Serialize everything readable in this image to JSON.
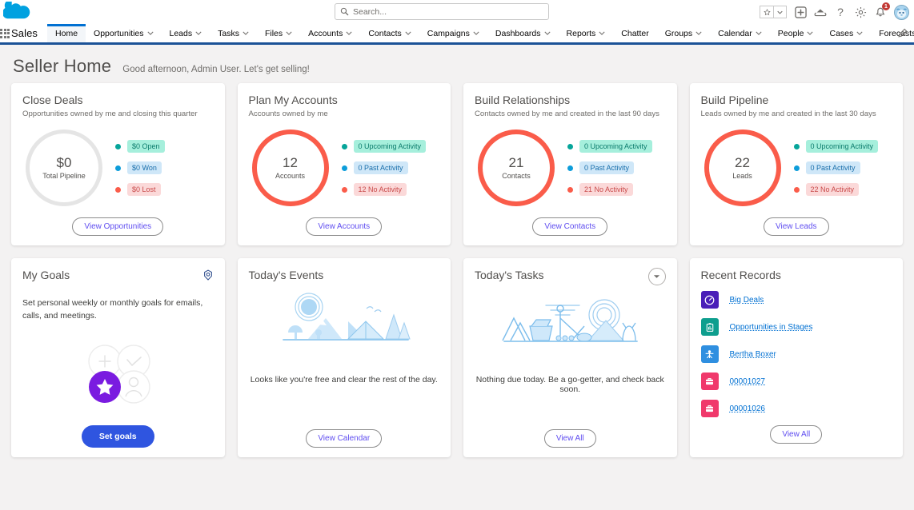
{
  "header": {
    "logo_icon": "salesforce-cloud-logo",
    "app_launcher_icon": "app-launcher-waffle-icon",
    "app_name": "Sales",
    "search": {
      "icon": "search-icon",
      "placeholder": "Search...",
      "value": ""
    },
    "actions": [
      {
        "name": "favorites-star-icon",
        "label": "★"
      },
      {
        "name": "favorites-dropdown-icon",
        "label": "▾"
      },
      {
        "name": "add-icon",
        "label": "+"
      },
      {
        "name": "learning-cloud-icon",
        "label": "☁"
      },
      {
        "name": "help-icon",
        "label": "?"
      },
      {
        "name": "setup-gear-icon",
        "label": "✿"
      },
      {
        "name": "notifications-bell-icon",
        "label": "🔔",
        "badge": "1"
      },
      {
        "name": "user-avatar",
        "label": ""
      }
    ],
    "notification_count": "1",
    "edit_nav_icon": "pencil-edit-icon"
  },
  "nav": {
    "items": [
      {
        "label": "Home",
        "has_menu": false,
        "active": true
      },
      {
        "label": "Opportunities",
        "has_menu": true,
        "active": false
      },
      {
        "label": "Leads",
        "has_menu": true,
        "active": false
      },
      {
        "label": "Tasks",
        "has_menu": true,
        "active": false
      },
      {
        "label": "Files",
        "has_menu": true,
        "active": false
      },
      {
        "label": "Accounts",
        "has_menu": true,
        "active": false
      },
      {
        "label": "Contacts",
        "has_menu": true,
        "active": false
      },
      {
        "label": "Campaigns",
        "has_menu": true,
        "active": false
      },
      {
        "label": "Dashboards",
        "has_menu": true,
        "active": false
      },
      {
        "label": "Reports",
        "has_menu": true,
        "active": false
      },
      {
        "label": "Chatter",
        "has_menu": false,
        "active": false
      },
      {
        "label": "Groups",
        "has_menu": true,
        "active": false
      },
      {
        "label": "Calendar",
        "has_menu": true,
        "active": false
      },
      {
        "label": "People",
        "has_menu": true,
        "active": false
      },
      {
        "label": "Cases",
        "has_menu": true,
        "active": false
      },
      {
        "label": "Forecasts",
        "has_menu": false,
        "active": false
      }
    ]
  },
  "page": {
    "title": "Seller Home",
    "greeting": "Good afternoon, Admin User. Let's get selling!"
  },
  "colors": {
    "brand_blue": "#0070d2",
    "nav_underline": "#1b5297",
    "donut_red": "#fa5c4a",
    "donut_empty": "#e5e5e5",
    "teal_dot": "#06a59a",
    "blue_dot": "#0d9dda",
    "red_dot": "#fa5c4a",
    "teal_pill_bg": "#a6efdc",
    "teal_pill_text": "#0a7a6b",
    "blue_pill_bg": "#cfe7f8",
    "blue_pill_text": "#1a6fab",
    "red_pill_bg": "#fbd9d9",
    "red_pill_text": "#c94a4a",
    "link_purple": "#5f4df0",
    "goal_button_blue": "#2f55e0",
    "goal_star_purple": "#7a1be0"
  },
  "cards": {
    "close_deals": {
      "title": "Close Deals",
      "subtitle": "Opportunities owned by me and closing this quarter",
      "donut": {
        "value": "$0",
        "caption": "Total Pipeline",
        "empty": true
      },
      "legend": [
        {
          "label": "$0 Open",
          "style": "teal"
        },
        {
          "label": "$0 Won",
          "style": "blue"
        },
        {
          "label": "$0 Lost",
          "style": "red"
        }
      ],
      "button": "View Opportunities"
    },
    "plan_my_accounts": {
      "title": "Plan My Accounts",
      "subtitle": "Accounts owned by me",
      "donut": {
        "value": "12",
        "caption": "Accounts",
        "empty": false
      },
      "legend": [
        {
          "label": "0 Upcoming Activity",
          "style": "teal"
        },
        {
          "label": "0 Past Activity",
          "style": "blue"
        },
        {
          "label": "12 No Activity",
          "style": "red"
        }
      ],
      "button": "View Accounts"
    },
    "build_relationships": {
      "title": "Build Relationships",
      "subtitle": "Contacts owned by me and created in the last 90 days",
      "donut": {
        "value": "21",
        "caption": "Contacts",
        "empty": false
      },
      "legend": [
        {
          "label": "0 Upcoming Activity",
          "style": "teal"
        },
        {
          "label": "0 Past Activity",
          "style": "blue"
        },
        {
          "label": "21 No Activity",
          "style": "red"
        }
      ],
      "button": "View Contacts"
    },
    "build_pipeline": {
      "title": "Build Pipeline",
      "subtitle": "Leads owned by me and created in the last 30 days",
      "donut": {
        "value": "22",
        "caption": "Leads",
        "empty": false
      },
      "legend": [
        {
          "label": "0 Upcoming Activity",
          "style": "teal"
        },
        {
          "label": "0 Past Activity",
          "style": "blue"
        },
        {
          "label": "22 No Activity",
          "style": "red"
        }
      ],
      "button": "View Leads"
    },
    "my_goals": {
      "title": "My Goals",
      "gear_icon": "goals-settings-gear-icon",
      "description": "Set personal weekly or monthly goals for emails, calls, and meetings.",
      "illustration": "goals-circles-illustration",
      "button": "Set goals"
    },
    "todays_events": {
      "title": "Today's Events",
      "illustration": "camping-scene-illustration",
      "message": "Looks like you're free and clear the rest of the day.",
      "button": "View Calendar"
    },
    "todays_tasks": {
      "title": "Today's Tasks",
      "dropdown_icon": "chevron-down-icon",
      "illustration": "construction-scene-illustration",
      "message": "Nothing due today. Be a go-getter, and check back soon.",
      "button": "View All"
    },
    "recent_records": {
      "title": "Recent Records",
      "items": [
        {
          "label": "Big Deals",
          "icon": "dashboard-icon",
          "color": "#4a1fb8"
        },
        {
          "label": "Opportunities in Stages",
          "icon": "report-icon",
          "color": "#0e9e8e"
        },
        {
          "label": "Bertha Boxer",
          "icon": "contact-icon",
          "color": "#2f8fe0"
        },
        {
          "label": "00001027",
          "icon": "case-icon",
          "color": "#f0386b"
        },
        {
          "label": "00001026",
          "icon": "case-icon",
          "color": "#f0386b"
        }
      ],
      "button": "View All"
    }
  }
}
